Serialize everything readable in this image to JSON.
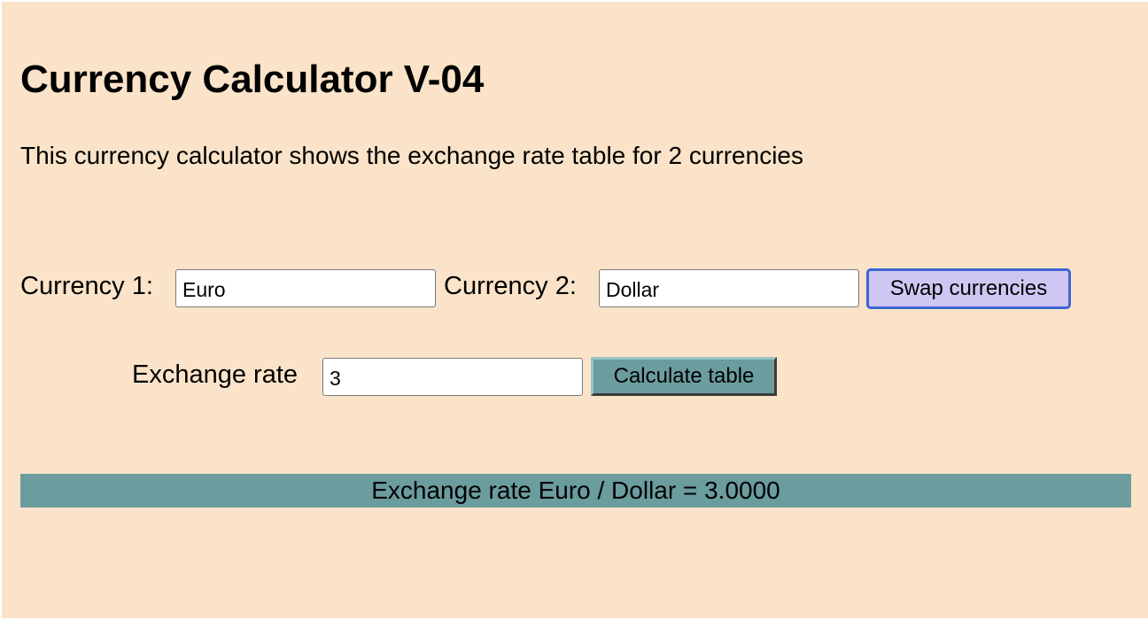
{
  "title": "Currency Calculator V-04",
  "intro": "This currency calculator shows the exchange rate table for 2 currencies",
  "currency1": {
    "label": "Currency 1:",
    "value": "Euro"
  },
  "currency2": {
    "label": "Currency 2:",
    "value": "Dollar"
  },
  "swap_button": "Swap currencies",
  "rate": {
    "label": "Exchange rate",
    "value": "3"
  },
  "calculate_button": "Calculate table",
  "result": "Exchange rate Euro / Dollar = 3.0000",
  "colors": {
    "page_background": "#fae3c8",
    "accent_teal": "#6b9c9e",
    "swap_button_bg": "#cfc6f3",
    "focus_ring": "#3b66d2"
  }
}
